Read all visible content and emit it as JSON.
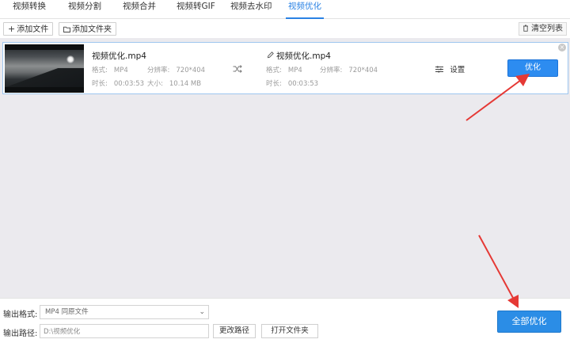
{
  "tabs": [
    {
      "label": "视频转换"
    },
    {
      "label": "视频分割"
    },
    {
      "label": "视频合并"
    },
    {
      "label": "视频转GIF"
    },
    {
      "label": "视频去水印"
    },
    {
      "label": "视频优化",
      "active": true
    }
  ],
  "toolbar": {
    "add_file": "添加文件",
    "add_folder": "添加文件夹",
    "clear_list": "清空列表"
  },
  "item": {
    "source": {
      "name": "视频优化.mp4",
      "format_label": "格式:",
      "format": "MP4",
      "resolution_label": "分辨率:",
      "resolution": "720*404",
      "duration_label": "时长:",
      "duration": "00:03:53",
      "size_label": "大小:",
      "size": "10.14 MB"
    },
    "output": {
      "name": "视频优化.mp4",
      "format_label": "格式:",
      "format": "MP4",
      "resolution_label": "分辨率:",
      "resolution": "720*404",
      "duration_label": "时长:",
      "duration": "00:03:53"
    },
    "settings_label": "设置",
    "optimize_label": "优化"
  },
  "bottom": {
    "format_label": "输出格式:",
    "format_value": "MP4  同原文件",
    "path_label": "输出路径:",
    "path_value": "D:\\视频优化",
    "change_path": "更改路径",
    "open_folder": "打开文件夹",
    "optimize_all": "全部优化"
  },
  "colors": {
    "accent": "#2a82e4",
    "button_blue": "#2d8cf0",
    "arrow_red": "#e53935"
  }
}
